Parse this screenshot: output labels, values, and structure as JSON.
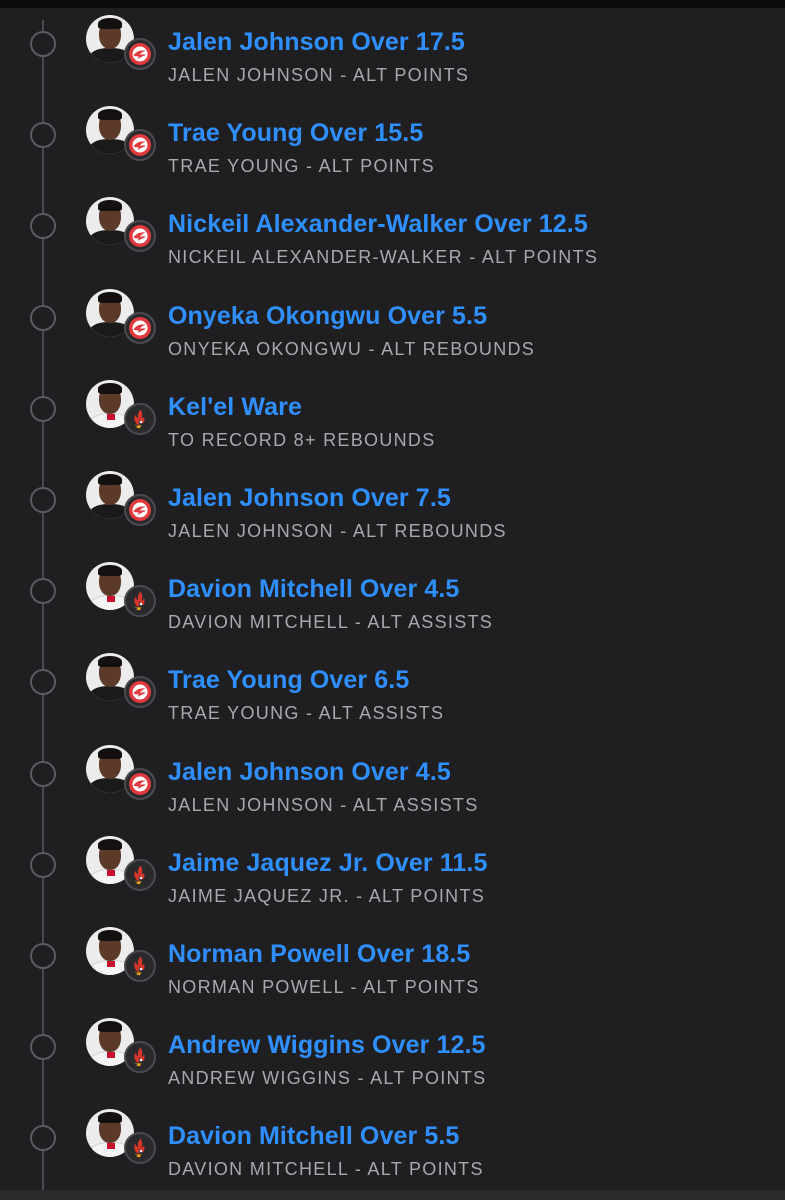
{
  "colors": {
    "background": "#1f1f21",
    "title_blue": "#2f8fff",
    "subtitle_gray": "#a8a8ad",
    "hawks_red": "#e03a3e",
    "heat_red": "#98002e"
  },
  "legs": [
    {
      "title": "Jalen Johnson Over 17.5",
      "subtitle": "JALEN JOHNSON - ALT POINTS",
      "team": "atl",
      "team_icon": "hawks-logo-icon"
    },
    {
      "title": "Trae Young Over 15.5",
      "subtitle": "TRAE YOUNG - ALT POINTS",
      "team": "atl",
      "team_icon": "hawks-logo-icon"
    },
    {
      "title": "Nickeil Alexander-Walker Over 12.5",
      "subtitle": "NICKEIL ALEXANDER-WALKER - ALT POINTS",
      "team": "atl",
      "team_icon": "hawks-logo-icon"
    },
    {
      "title": "Onyeka Okongwu Over 5.5",
      "subtitle": "ONYEKA OKONGWU - ALT REBOUNDS",
      "team": "atl",
      "team_icon": "hawks-logo-icon"
    },
    {
      "title": "Kel'el Ware",
      "subtitle": "TO RECORD 8+ REBOUNDS",
      "team": "mia",
      "team_icon": "heat-logo-icon"
    },
    {
      "title": "Jalen Johnson Over 7.5",
      "subtitle": "JALEN JOHNSON - ALT REBOUNDS",
      "team": "atl",
      "team_icon": "hawks-logo-icon"
    },
    {
      "title": "Davion Mitchell Over 4.5",
      "subtitle": "DAVION MITCHELL - ALT ASSISTS",
      "team": "mia",
      "team_icon": "heat-logo-icon"
    },
    {
      "title": "Trae Young Over 6.5",
      "subtitle": "TRAE YOUNG - ALT ASSISTS",
      "team": "atl",
      "team_icon": "hawks-logo-icon"
    },
    {
      "title": "Jalen Johnson Over 4.5",
      "subtitle": "JALEN JOHNSON - ALT ASSISTS",
      "team": "atl",
      "team_icon": "hawks-logo-icon"
    },
    {
      "title": "Jaime Jaquez Jr. Over 11.5",
      "subtitle": "JAIME JAQUEZ JR. - ALT POINTS",
      "team": "mia",
      "team_icon": "heat-logo-icon"
    },
    {
      "title": "Norman Powell Over 18.5",
      "subtitle": "NORMAN POWELL - ALT POINTS",
      "team": "mia",
      "team_icon": "heat-logo-icon"
    },
    {
      "title": "Andrew Wiggins Over 12.5",
      "subtitle": "ANDREW WIGGINS - ALT POINTS",
      "team": "mia",
      "team_icon": "heat-logo-icon"
    },
    {
      "title": "Davion Mitchell Over 5.5",
      "subtitle": "DAVION MITCHELL - ALT POINTS",
      "team": "mia",
      "team_icon": "heat-logo-icon"
    }
  ]
}
